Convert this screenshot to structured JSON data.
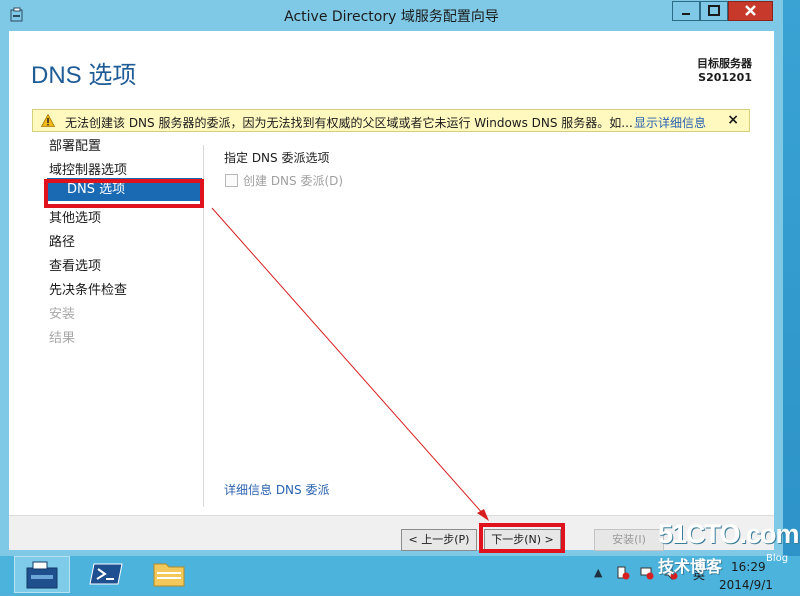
{
  "window": {
    "title": "Active Directory 域服务配置向导"
  },
  "header": {
    "page_title": "DNS 选项",
    "server_label": "目标服务器",
    "server_name": "S201201"
  },
  "warning": {
    "text": "无法创建该 DNS 服务器的委派，因为无法找到有权威的父区域或者它未运行 Windows DNS 服务器。如...",
    "link": "显示详细信息",
    "close": "×"
  },
  "nav": {
    "items": [
      {
        "label": "部署配置",
        "state": "normal"
      },
      {
        "label": "域控制器选项",
        "state": "normal"
      },
      {
        "label": "DNS 选项",
        "state": "selected"
      },
      {
        "label": "其他选项",
        "state": "normal"
      },
      {
        "label": "路径",
        "state": "normal"
      },
      {
        "label": "查看选项",
        "state": "normal"
      },
      {
        "label": "先决条件检查",
        "state": "normal"
      },
      {
        "label": "安装",
        "state": "disabled"
      },
      {
        "label": "结果",
        "state": "disabled"
      }
    ]
  },
  "content": {
    "section_title": "指定 DNS 委派选项",
    "checkbox_label": "创建 DNS 委派(D)",
    "checkbox_checked": false,
    "more_link": "详细信息 DNS 委派"
  },
  "footer": {
    "prev": "< 上一步(P)",
    "next": "下一步(N) >",
    "install": "安装(I)"
  },
  "tray": {
    "lang": "英",
    "time": "16:29",
    "date": "2014/9/1"
  },
  "watermark": {
    "main": "51CTO.com",
    "sub": "技术博客",
    "blog": "Blog"
  },
  "colors": {
    "accent": "#1969b3",
    "titlebar": "#7fc9e6",
    "highlight": "#e0121e"
  }
}
